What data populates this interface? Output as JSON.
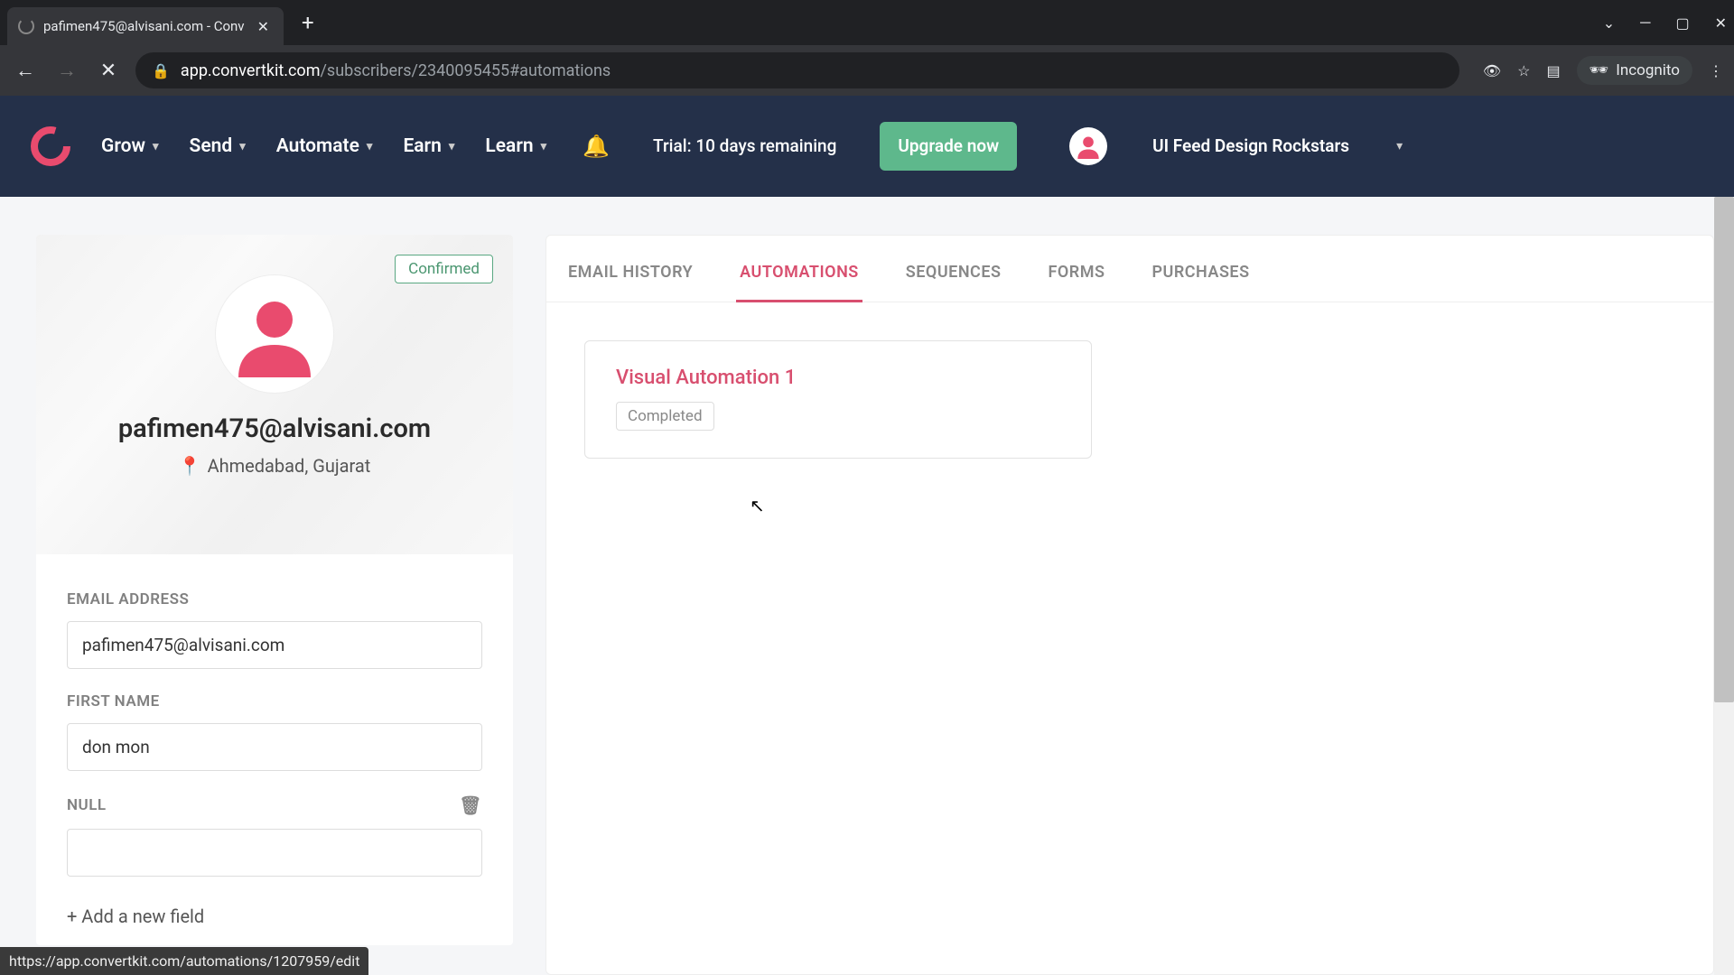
{
  "browser": {
    "tab_title": "pafimen475@alvisani.com - Conv",
    "url_host": "app.convertkit.com",
    "url_path": "/subscribers/2340095455#automations",
    "incognito_label": "Incognito"
  },
  "header": {
    "nav": [
      "Grow",
      "Send",
      "Automate",
      "Earn",
      "Learn"
    ],
    "trial": "Trial: 10 days remaining",
    "upgrade": "Upgrade now",
    "account": "UI Feed Design Rockstars"
  },
  "profile": {
    "status_badge": "Confirmed",
    "email_display": "pafimen475@alvisani.com",
    "location": "Ahmedabad, Gujarat",
    "fields": {
      "email_label": "EMAIL ADDRESS",
      "email_value": "pafimen475@alvisani.com",
      "firstname_label": "FIRST NAME",
      "firstname_value": "don mon",
      "null_label": "NULL",
      "null_value": ""
    },
    "add_field": "+ Add a new field"
  },
  "tabs": [
    "EMAIL HISTORY",
    "AUTOMATIONS",
    "SEQUENCES",
    "FORMS",
    "PURCHASES"
  ],
  "active_tab_index": 1,
  "automation_card": {
    "title": "Visual Automation 1",
    "status": "Completed"
  },
  "status_bar": "https://app.convertkit.com/automations/1207959/edit",
  "colors": {
    "header_bg": "#243049",
    "accent": "#d84f6f",
    "green": "#5eb88c"
  }
}
